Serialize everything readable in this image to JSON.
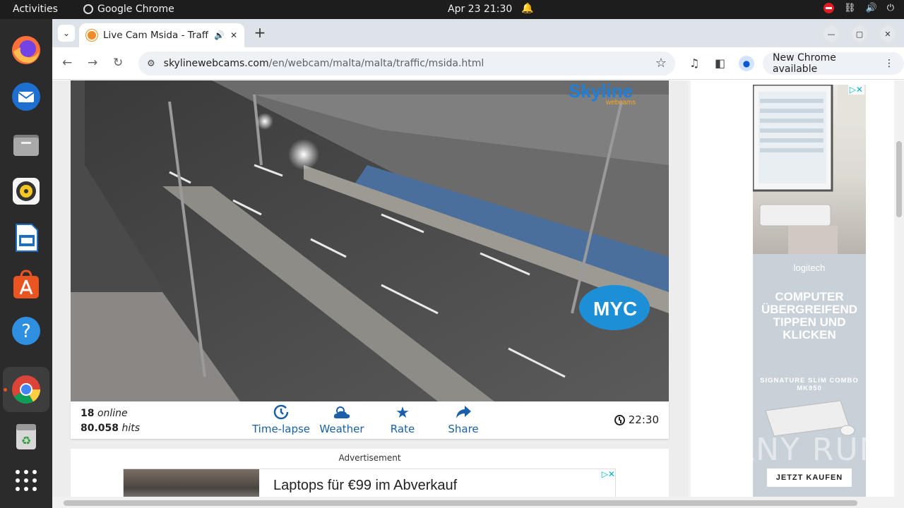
{
  "topbar": {
    "activities": "Activities",
    "app_name": "Google Chrome",
    "datetime": "Apr 23  21:30"
  },
  "dock": {
    "items": [
      "firefox-icon",
      "thunderbird-icon",
      "files-icon",
      "rhythmbox-icon",
      "writer-icon",
      "software-icon",
      "help-icon",
      "chrome-icon",
      "trash-icon",
      "apps-grid-icon"
    ]
  },
  "browser": {
    "tab_title": "Live Cam Msida - Traffi",
    "url_host": "skylinewebcams.com",
    "url_path": "/en/webcam/malta/malta/traffic/msida.html",
    "update_button": "New Chrome available"
  },
  "webcam": {
    "online_count": "18",
    "online_label": "online",
    "hits_count": "80.058",
    "hits_label": "hits",
    "actions": {
      "timelapse": "Time-lapse",
      "weather": "Weather",
      "rate": "Rate",
      "share": "Share"
    },
    "time": "22:30",
    "brand_logo": "Skyline",
    "brand_sub": "webcams",
    "overlay_logo": "MYC"
  },
  "ads": {
    "label": "Advertisement",
    "banner_headline": "Laptops für €99 im Abverkauf",
    "sky_brand": "logitech",
    "sky_headline": "COMPUTER ÜBERGREIFEND TIPPEN UND KLICKEN",
    "sky_product": "SIGNATURE SLIM COMBO MK950",
    "sky_cta": "JETZT KAUFEN"
  },
  "watermark": "ANY RUN",
  "colors": {
    "accent_blue": "#1a5fa8",
    "ubuntu_orange": "#e95420",
    "topbar": "#1d1d1d"
  }
}
